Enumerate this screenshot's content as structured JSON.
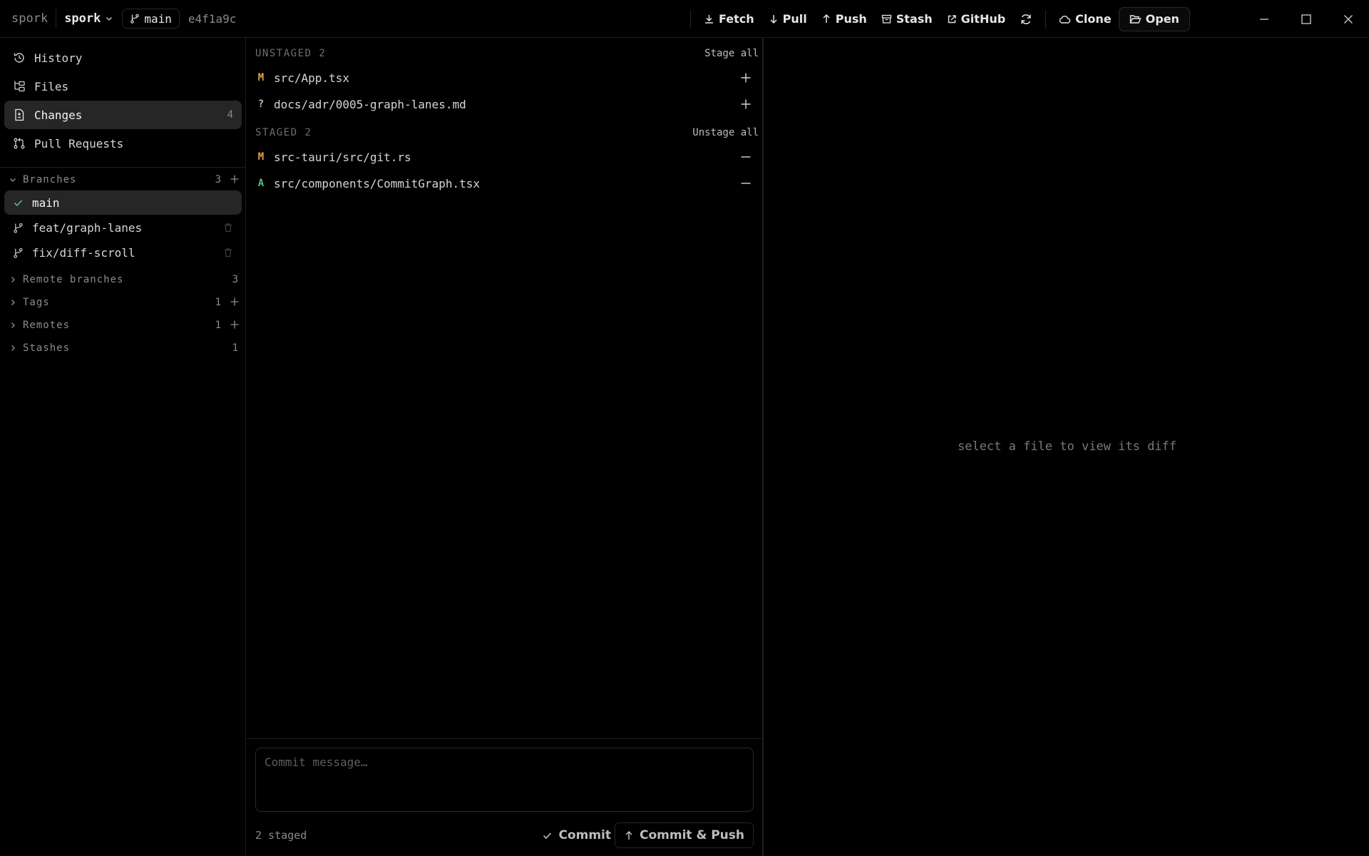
{
  "titlebar": {
    "app_name": "spork",
    "repo_name": "spork",
    "branch": "main",
    "commit_hash": "e4f1a9c",
    "actions": {
      "fetch": "Fetch",
      "pull": "Pull",
      "push": "Push",
      "stash": "Stash",
      "github": "GitHub",
      "clone": "Clone",
      "open": "Open"
    }
  },
  "sidebar": {
    "nav": {
      "history": {
        "label": "History"
      },
      "files": {
        "label": "Files"
      },
      "changes": {
        "label": "Changes",
        "count": "4"
      },
      "pull_requests": {
        "label": "Pull Requests"
      }
    },
    "branches": {
      "label": "Branches",
      "count": "3",
      "items": [
        {
          "name": "main",
          "current": true
        },
        {
          "name": "feat/graph-lanes"
        },
        {
          "name": "fix/diff-scroll"
        }
      ]
    },
    "remote_branches": {
      "label": "Remote branches",
      "count": "3"
    },
    "tags": {
      "label": "Tags",
      "count": "1"
    },
    "remotes": {
      "label": "Remotes",
      "count": "1"
    },
    "stashes": {
      "label": "Stashes",
      "count": "1"
    }
  },
  "changes": {
    "unstaged": {
      "label": "UNSTAGED 2",
      "action": "Stage all",
      "files": [
        {
          "status": "M",
          "path": "src/App.tsx"
        },
        {
          "status": "?",
          "path": "docs/adr/0005-graph-lanes.md"
        }
      ]
    },
    "staged": {
      "label": "STAGED 2",
      "action": "Unstage all",
      "files": [
        {
          "status": "M",
          "path": "src-tauri/src/git.rs"
        },
        {
          "status": "A",
          "path": "src/components/CommitGraph.tsx"
        }
      ]
    },
    "commit": {
      "placeholder": "Commit message…",
      "staged_count": "2 staged",
      "commit_label": "Commit",
      "commit_push_label": "Commit & Push"
    }
  },
  "diff": {
    "empty_message": "select a file to view its diff"
  },
  "colors": {
    "modified": "#e5a04b",
    "added": "#4fbf7a",
    "untracked": "#bdbdbd",
    "check": "#4fbf7a"
  }
}
